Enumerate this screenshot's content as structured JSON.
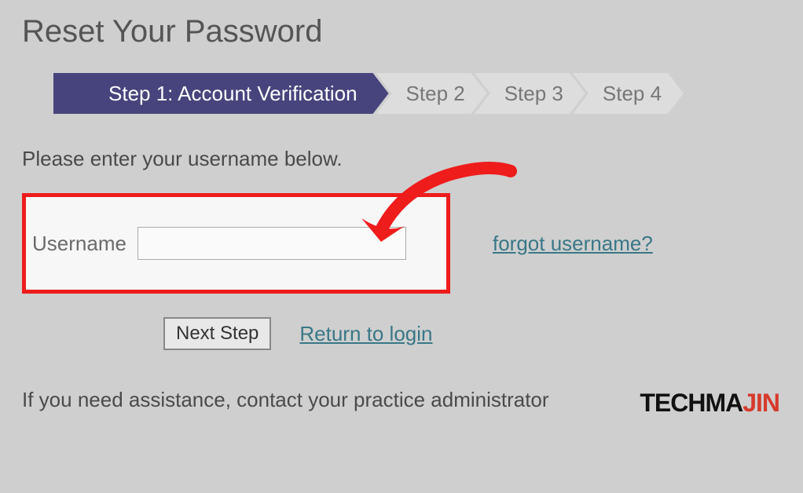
{
  "title": "Reset Your Password",
  "stepper": {
    "steps": [
      {
        "label": "Step 1: Account Verification",
        "active": true
      },
      {
        "label": "Step 2",
        "active": false
      },
      {
        "label": "Step 3",
        "active": false
      },
      {
        "label": "Step 4",
        "active": false
      }
    ]
  },
  "instruction": "Please enter your username below.",
  "form": {
    "username_label": "Username",
    "username_value": "",
    "forgot_link": "forgot username?"
  },
  "actions": {
    "next_label": "Next Step",
    "return_link": "Return to login"
  },
  "assistance": "If you need assistance, contact your practice administrator",
  "watermark": {
    "part1": "TECH",
    "part2": "MA",
    "part3": "JIN"
  }
}
